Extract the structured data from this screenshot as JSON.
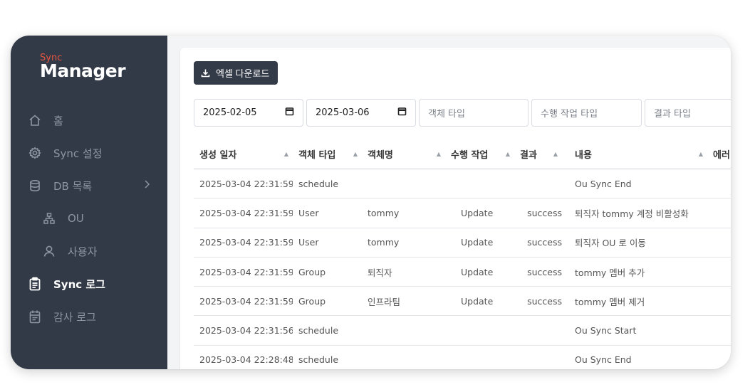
{
  "logo": {
    "top": "Sync",
    "main": "Manager"
  },
  "sidebar": {
    "items": [
      {
        "label": "홈",
        "icon": "home-icon"
      },
      {
        "label": "Sync 설정",
        "icon": "gear-icon"
      },
      {
        "label": "DB 목록",
        "icon": "database-icon"
      },
      {
        "label": "OU",
        "icon": "sitemap-icon"
      },
      {
        "label": "사용자",
        "icon": "user-icon"
      },
      {
        "label": "Sync 로그",
        "icon": "clipboard-icon"
      },
      {
        "label": "감사 로그",
        "icon": "calendar-icon"
      }
    ]
  },
  "toolbar": {
    "excel_label": "엑셀 다운로드"
  },
  "filters": {
    "start_date": "2025-02-05",
    "end_date": "2025-03-06",
    "object_type_placeholder": "객체 타입",
    "action_type_placeholder": "수행 작업 타입",
    "result_type_placeholder": "결과 타입"
  },
  "table": {
    "headers": [
      "생성 일자",
      "객체 타입",
      "객체명",
      "수행 작업",
      "결과",
      "내용",
      "에러"
    ],
    "rows": [
      [
        "2025-03-04 22:31:59",
        "schedule",
        "",
        "",
        "",
        "Ou Sync End"
      ],
      [
        "2025-03-04 22:31:59",
        "User",
        "tommy",
        "Update",
        "success",
        "퇴직자 tommy 계정 비활성화"
      ],
      [
        "2025-03-04 22:31:59",
        "User",
        "tommy",
        "Update",
        "success",
        "퇴직자 OU 로 이동"
      ],
      [
        "2025-03-04 22:31:59",
        "Group",
        "퇴직자",
        "Update",
        "success",
        "tommy 멤버 추가"
      ],
      [
        "2025-03-04 22:31:59",
        "Group",
        "인프라팀",
        "Update",
        "success",
        "tommy 멤버 제거"
      ],
      [
        "2025-03-04 22:31:56",
        "schedule",
        "",
        "",
        "",
        "Ou Sync Start"
      ],
      [
        "2025-03-04 22:28:48",
        "schedule",
        "",
        "",
        "",
        "Ou Sync End"
      ]
    ]
  },
  "colors": {
    "sidebar_bg": "#333a47",
    "accent_logo": "#e4553f",
    "button_bg": "#343b48"
  }
}
